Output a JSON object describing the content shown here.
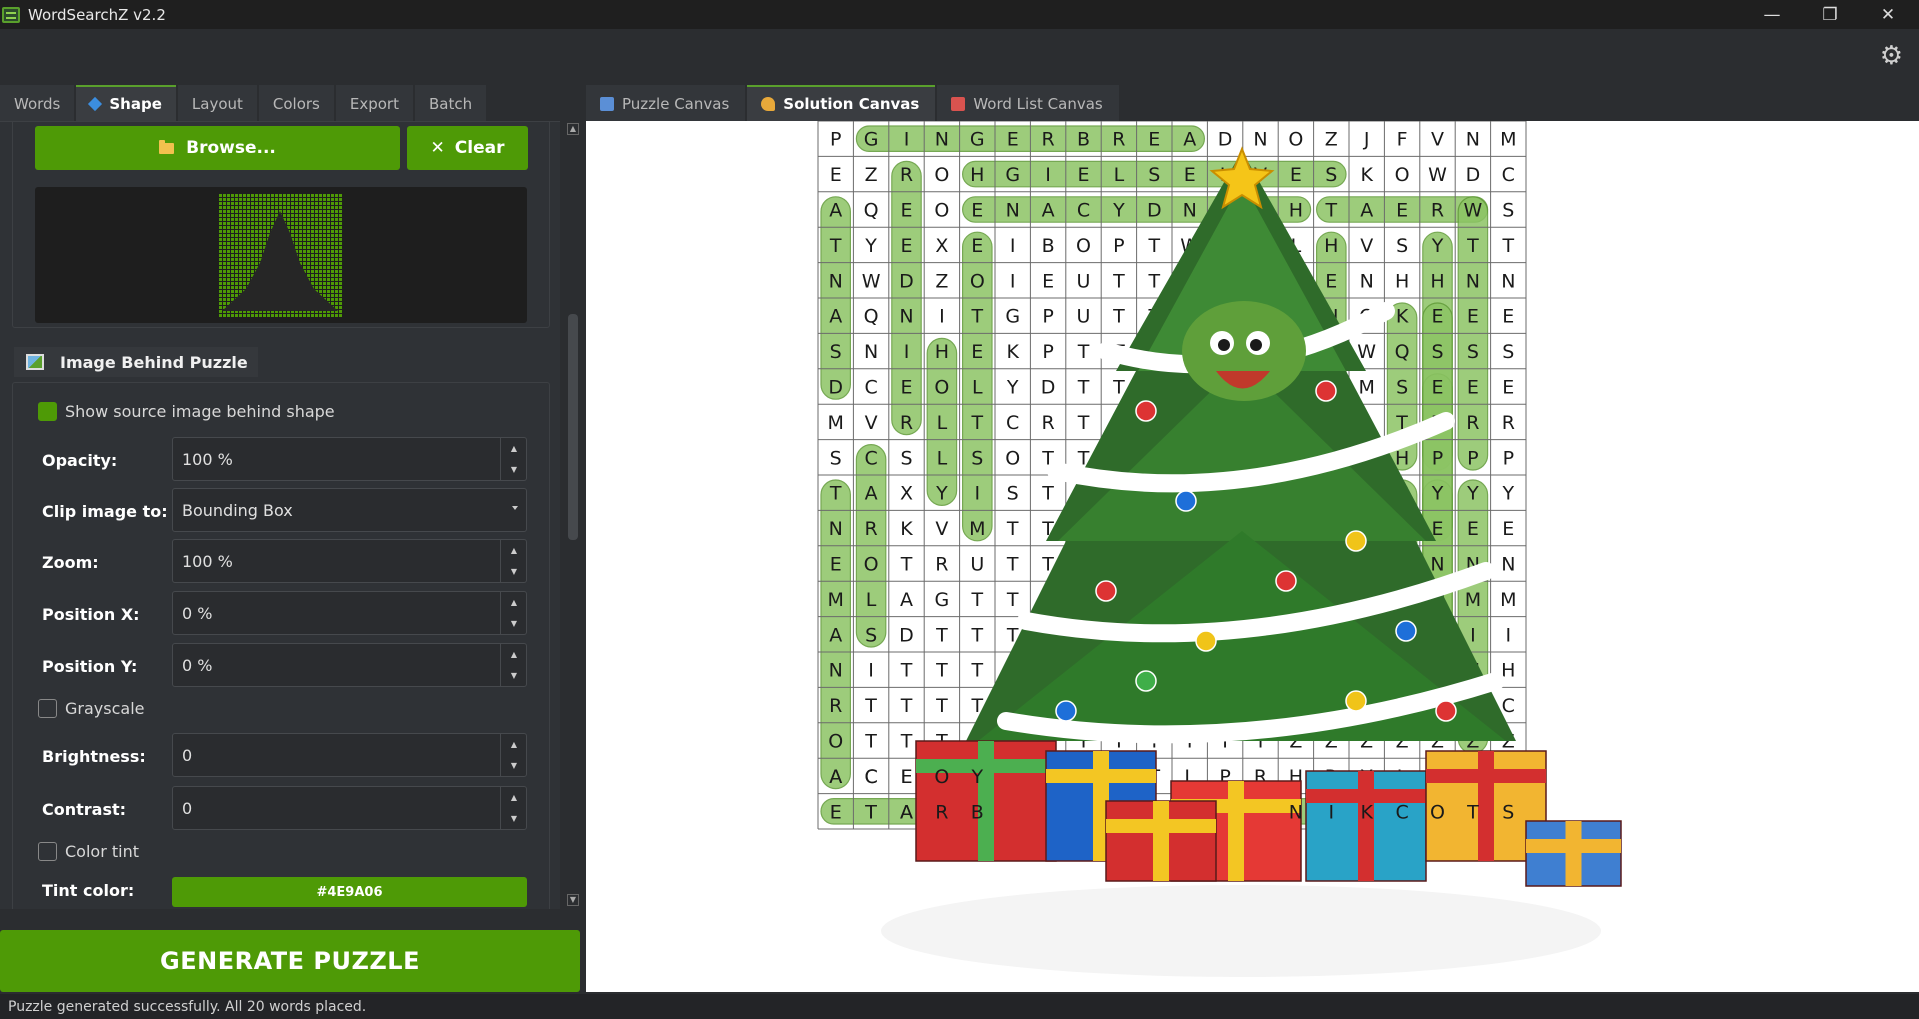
{
  "app": {
    "title": "WordSearchZ v2.2"
  },
  "window_controls": {
    "minimize": "—",
    "maximize": "❐",
    "close": "✕"
  },
  "left_tabs": [
    "Words",
    "Shape",
    "Layout",
    "Colors",
    "Export",
    "Batch"
  ],
  "shape": {
    "browse_label": "Browse...",
    "clear_label": "Clear"
  },
  "image_behind": {
    "title": "Image Behind Puzzle",
    "show_source": "Show source image behind shape",
    "opacity_label": "Opacity:",
    "opacity": "100 %",
    "clip_label": "Clip image to:",
    "clip": "Bounding Box",
    "zoom_label": "Zoom:",
    "zoom": "100 %",
    "posx_label": "Position X:",
    "posx": "0 %",
    "posy_label": "Position Y:",
    "posy": "0 %",
    "grayscale": "Grayscale",
    "brightness_label": "Brightness:",
    "brightness": "0",
    "contrast_label": "Contrast:",
    "contrast": "0",
    "color_tint": "Color tint",
    "tint_label": "Tint color:",
    "tint": "#4E9A06"
  },
  "generate_label": "GENERATE PUZZLE",
  "status": "Puzzle generated successfully. All 20 words placed.",
  "right_tabs": [
    "Puzzle Canvas",
    "Solution Canvas",
    "Word List Canvas"
  ],
  "colors": {
    "accent": "#4e9a06",
    "highlight": "#8cc464",
    "background": "#2b2d30"
  },
  "icons": {
    "settings": "gear-icon",
    "browse": "folder-icon",
    "clear": "close-icon",
    "image": "image-icon"
  },
  "grid": [
    "PGINGERBREADNOZJFVNM",
    "EZROHGIELSELVESKOWDC",
    "AQEOENACYDNACHTAERWS",
    "TYEXEIBOPTWUELHVSYTT",
    "NWDZOIEUTTTGETENHHNN",
    "AQNITGPUTTTPSQNOKEEE",
    "SNIHEKPTTTHPNOOWQSSS",
    "DCEOLYDTTTTDIORMSEEE",
    "MVRLTCRTTTTXTZTATRRR",
    "SCSLSOTTTTTTJDHNHPPP",
    "TAXYISTTTTTTTOPLGYYY",
    "NRKVMTTTTTTTSPOEIEEE",
    "EOTRUTTTTTTTTZLGLNNN",
    "MLAGTTTTTTTTTENHMMMM",
    "ASDTTTTTTTTTTAQIIIII",
    "NITTTTTTTTTTTTFHHHHH",
    "RTTTTTTTTTTTTTCCCCCC",
    "OTTTTTTTTTTTTZZZZZZZ",
    "ACEOYTTTTTLPRHRYLLLL",
    "ETARBELECVJGGNIKCOTS"
  ]
}
